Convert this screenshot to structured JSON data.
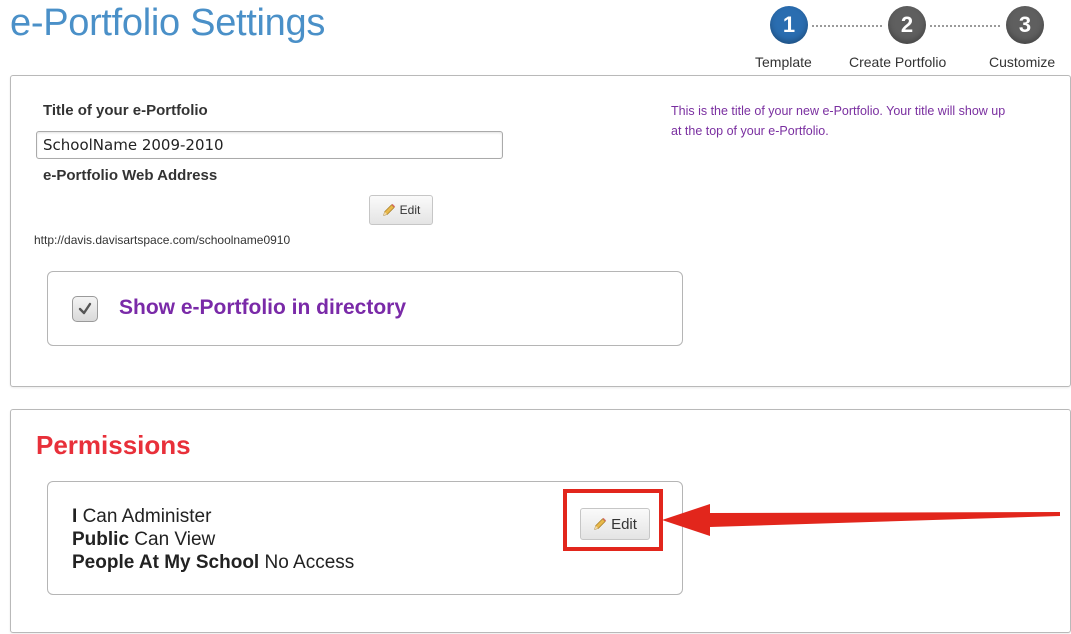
{
  "header": {
    "title": "e-Portfolio Settings",
    "steps": [
      {
        "number": "1",
        "label": "Template",
        "active": true
      },
      {
        "number": "2",
        "label": "Create Portfolio",
        "active": false
      },
      {
        "number": "3",
        "label": "Customize",
        "active": false
      }
    ]
  },
  "general": {
    "title_label": "Title of your e-Portfolio",
    "title_value": "SchoolName 2009-2010",
    "help_text": "This is the title of your new e-Portfolio. Your title will show up at the top of your e-Portfolio.",
    "address_label": "e-Portfolio Web Address",
    "edit_label": "Edit",
    "web_address": "http://davis.davisartspace.com/schoolname0910",
    "directory_label": "Show e-Portfolio in directory",
    "directory_checked": true
  },
  "permissions": {
    "title": "Permissions",
    "edit_label": "Edit",
    "entries": [
      {
        "who": "I",
        "access": "Can Administer"
      },
      {
        "who": "Public",
        "access": "Can View"
      },
      {
        "who": "People At My School",
        "access": "No Access"
      }
    ]
  },
  "colors": {
    "title_blue": "#4a90c8",
    "step_active": "#2a6db0",
    "step_inactive": "#5f5f5f",
    "help_purple": "#7a2fa0",
    "permissions_red": "#e8303a",
    "annotation_red": "#e2261c"
  }
}
